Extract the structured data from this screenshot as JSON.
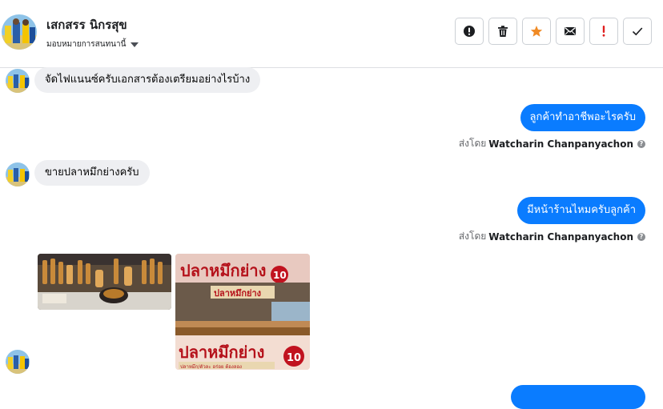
{
  "header": {
    "name": "เสกสรร นิกรสุข",
    "assign_label": "มอบหมายการสนทนานี้",
    "actions": [
      {
        "icon": "alert-icon",
        "color": "#1c1e21"
      },
      {
        "icon": "trash-icon",
        "color": "#1c1e21"
      },
      {
        "icon": "star-icon",
        "color": "#f08a24"
      },
      {
        "icon": "mail-icon",
        "color": "#1c1e21"
      },
      {
        "icon": "exclamation-icon",
        "color": "#e02020"
      },
      {
        "icon": "check-icon",
        "color": "#1c1e21"
      }
    ]
  },
  "messages": {
    "m1": "จัดไฟแนนซ์ครับเอกสารต้องเตรียมอย่างไรบ้าง",
    "m2": "ลูกค้าทำอาชีพอะไรครับ",
    "m3": "ขายปลาหมึกย่างครับ",
    "m4": "มีหน้าร้านไหมครับลูกค้า"
  },
  "sent_by": {
    "prefix": "ส่งโดย",
    "agent": "Watcharin Chanpanyachon",
    "help": "?"
  },
  "photo2_text": {
    "top_sign": "ปลาหมึกย่าง",
    "sub_sign": "ปลาหมึกย่าง",
    "bottom_sign": "ปลาหมึกย่าง",
    "price": "10",
    "strip": "ปลาหมึก/ตัวละ อร่อย ต้องลอง"
  },
  "colors": {
    "accent": "#0a7cff",
    "incoming_bubble": "#eeeff2",
    "star": "#f08a24",
    "danger": "#e02020"
  }
}
